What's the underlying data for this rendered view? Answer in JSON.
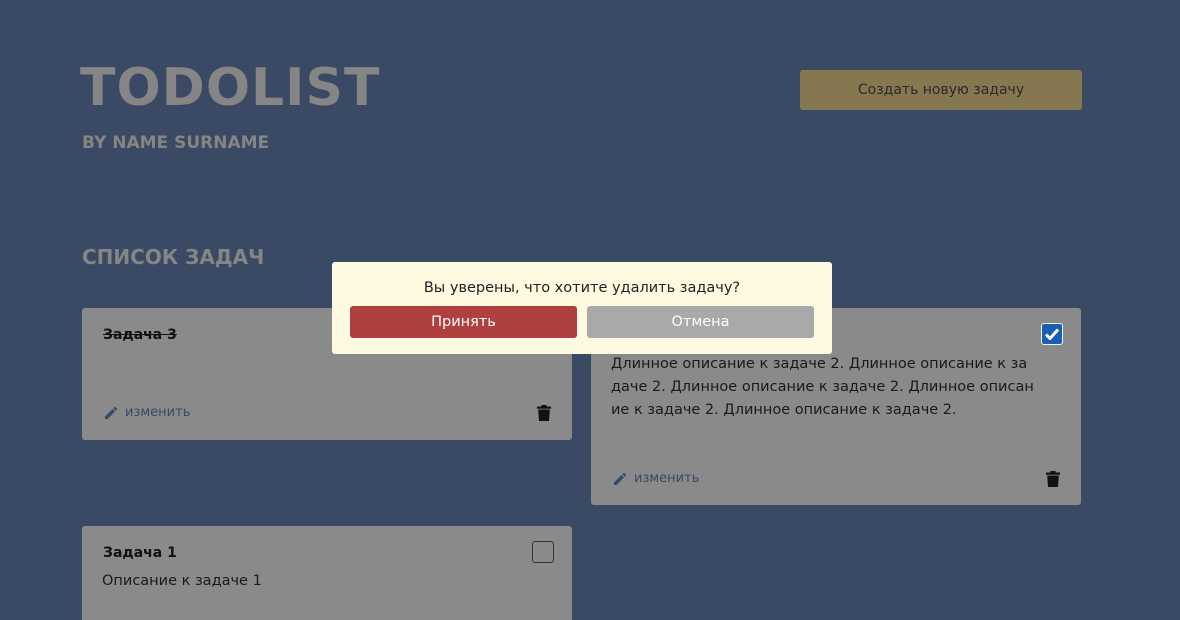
{
  "header": {
    "title": "TODOLIST",
    "subtitle": "BY NAME SURNAME",
    "create_button": "Создать новую задачу"
  },
  "section": {
    "title": "СПИСОК ЗАДАЧ"
  },
  "tasks": [
    {
      "title": "Задача 3",
      "description": "",
      "done": true,
      "edit_label": "изменить"
    },
    {
      "title": "",
      "description_lines": [
        "Длинное описание к задаче 2. Длинное описание к за",
        "даче 2. Длинное описание к задаче 2. Длинное описан",
        "ие к задаче 2. Длинное описание к задаче 2."
      ],
      "done": true,
      "edit_label": "изменить"
    },
    {
      "title": "Задача 1",
      "description": "Описание к задаче 1",
      "done": false
    }
  ],
  "modal": {
    "message": "Вы уверены, что хотите удалить задачу?",
    "accept_label": "Принять",
    "cancel_label": "Отмена"
  },
  "colors": {
    "background": "#3a4a64",
    "card": "#8a8a8a",
    "create_button": "#857750",
    "accept": "#b04040",
    "cancel": "#a9a9a9",
    "checkbox_checked": "#1a5fb4",
    "modal_bg": "#fefae2"
  }
}
